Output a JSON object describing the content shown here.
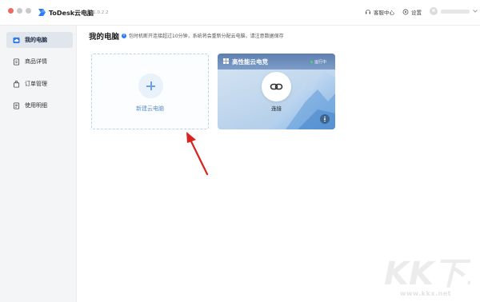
{
  "app": {
    "title": "ToDesk云电脑",
    "version": "v1.0.2.2",
    "colors": {
      "accent": "#2b7cf0",
      "status_running": "#4cd56a",
      "close_dot": "#ee6a5f"
    }
  },
  "toolbar": {
    "support_label": "客服中心",
    "settings_label": "设置"
  },
  "sidebar": {
    "items": [
      {
        "label": "我的电脑",
        "icon": "cloud-icon",
        "active": true
      },
      {
        "label": "商品详情",
        "icon": "product-icon",
        "active": false
      },
      {
        "label": "订单管理",
        "icon": "bag-icon",
        "active": false
      },
      {
        "label": "使用明细",
        "icon": "list-icon",
        "active": false
      }
    ]
  },
  "main": {
    "title": "我的电脑",
    "notice": "包时机断开连接超过10分钟，系统将会重新分配云电脑，请注意数据保存",
    "new_card": {
      "label": "新建云电脑",
      "icon": "plus-icon"
    },
    "pc_card": {
      "name": "高性能云电竞",
      "status": "运行中",
      "connect_label": "连接",
      "icon": "link-icon"
    }
  },
  "watermark": {
    "logo_text": "KK下载",
    "url": "www.kkx.net"
  }
}
